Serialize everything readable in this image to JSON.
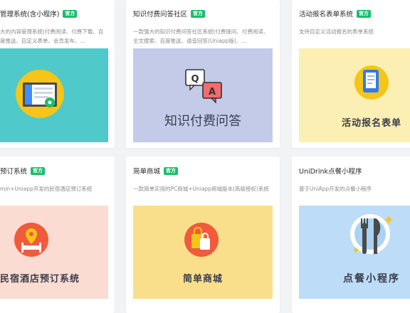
{
  "badge_text": "官方",
  "cards": [
    {
      "title": "管理系统(含小程序)",
      "desc": "大的内容管理系统(付费阅读、付费下载、百度推送、自定义表单、会员发布、…",
      "image_bg": "#4fc9c9",
      "icon": "admin-dashboard-icon"
    },
    {
      "title": "知识付费问答社区",
      "desc": "一款强大的知识付费问答社区系统(付费提问、付费阅读、全文搜索、百度推送、语音回答(Uniapp版)、…",
      "image_bg": "#c3cbe8",
      "caption": "知识付费问答",
      "icon": "qa-chat-icon"
    },
    {
      "title": "活动报名表单系统",
      "desc": "支持自定义活动报名的表单系统",
      "image_bg": "#fcefb4",
      "caption": "活动报名表单",
      "icon": "form-document-icon"
    },
    {
      "title": "预订系统",
      "desc": "min+Uniapp开发的民宿酒店预订系统",
      "image_bg": "#fbdcd2",
      "caption": "民宿酒店预订系统",
      "icon": "location-bed-icon"
    },
    {
      "title": "简单商城",
      "desc": "一款简单实用的PC商城+Uniapp商城版本(高级授权)系统",
      "image_bg": "#f9df8b",
      "caption": "简单商城",
      "icon": "shopping-bag-icon"
    },
    {
      "title": "UniDrink点餐小程序",
      "desc": "基于UniApp开发的点餐小程序",
      "image_bg": "#bcdcf7",
      "caption": "点餐小程序",
      "icon": "fork-knife-icon",
      "no_badge": true
    }
  ]
}
